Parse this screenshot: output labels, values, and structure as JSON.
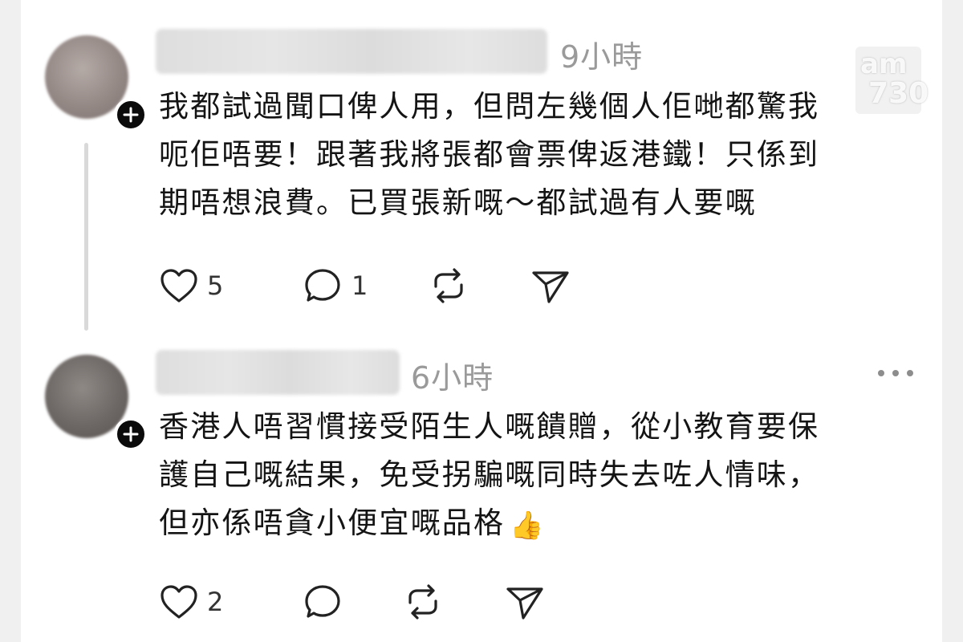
{
  "posts": [
    {
      "time": "9小時",
      "lines": [
        "我都試過聞口俾人用，但問左幾個人佢哋都驚我",
        "呃佢唔要！跟著我將張都會票俾返港鐵！只係到",
        "期唔想浪費。已買張新嘅～都試過有人要嘅"
      ],
      "likes": "5",
      "replies": "1",
      "reposts": "",
      "shares": ""
    },
    {
      "time": "6小時",
      "lines": [
        "香港人唔習慣接受陌生人嘅饋贈，從小教育要保",
        "護自己嘅結果，免受拐騙嘅同時失去咗人情味，",
        "但亦係唔貪小便宜嘅品格"
      ],
      "emoji": "👍",
      "likes": "2",
      "replies": "",
      "reposts": "",
      "shares": ""
    }
  ],
  "watermark": {
    "line1": "am",
    "line2": "730"
  },
  "icons": {
    "follow": "plus-icon",
    "like": "heart-icon",
    "reply": "comment-icon",
    "repost": "repost-icon",
    "share": "send-icon",
    "more": "more-icon"
  }
}
